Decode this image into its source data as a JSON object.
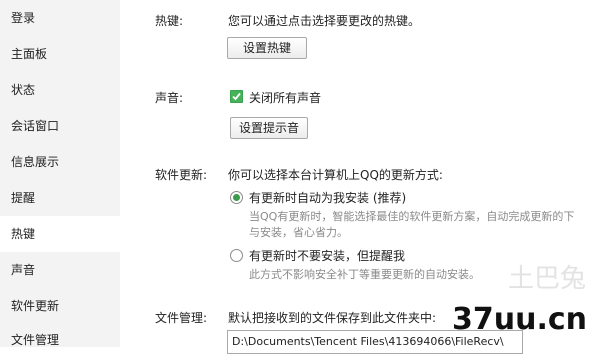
{
  "sidebar": {
    "items": [
      {
        "label": "登录"
      },
      {
        "label": "主面板"
      },
      {
        "label": "状态"
      },
      {
        "label": "会话窗口"
      },
      {
        "label": "信息展示"
      },
      {
        "label": "提醒"
      },
      {
        "label": "热键"
      },
      {
        "label": "声音"
      },
      {
        "label": "软件更新"
      },
      {
        "label": "文件管理"
      }
    ],
    "active": "热键"
  },
  "hotkey": {
    "label": "热键:",
    "description": "您可以通过点击选择要更改的热键。",
    "button": "设置热键"
  },
  "sound": {
    "label": "声音:",
    "mute_all": "关闭所有声音",
    "mute_all_checked": true,
    "button": "设置提示音"
  },
  "update": {
    "label": "软件更新:",
    "description": "你可以选择本台计算机上QQ的更新方式:",
    "option_auto": {
      "label": "有更新时自动为我安装 (推荐)",
      "hint_line1": "当QQ有更新时，智能选择最佳的软件更新方案，自动完成更新的下",
      "hint_line2": "与安装，省心省力。",
      "checked": true
    },
    "option_manual": {
      "label": "有更新时不要安装，但提醒我",
      "hint": "此方式不影响安全补丁等重要更新的自动安装。",
      "checked": false
    }
  },
  "files": {
    "label": "文件管理:",
    "description": "默认把接收到的文件保存到此文件夹中:",
    "path": "D:\\Documents\\Tencent Files\\413694066\\FileRecv\\"
  },
  "watermark": {
    "text": "37uu.cn",
    "faint_text": "土巴兔"
  },
  "colors": {
    "sidebar_bg": "#f3f3f3",
    "accent_green": "#45b35a"
  }
}
